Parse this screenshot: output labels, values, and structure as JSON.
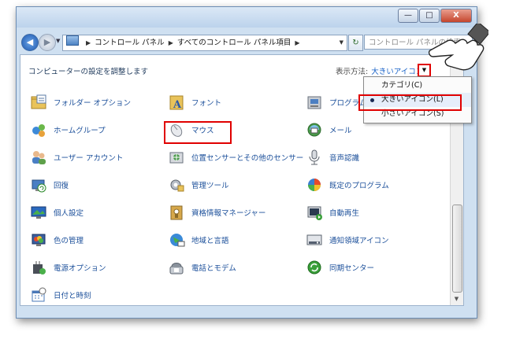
{
  "window": {
    "min_label": "—",
    "max_label": "□",
    "close_label": "X"
  },
  "address": {
    "crumb1": "コントロール パネル",
    "crumb2": "すべてのコントロール パネル項目",
    "search_placeholder": "コントロール パネルの検索"
  },
  "content": {
    "heading": "コンピューターの設定を調整します",
    "view_by_label": "表示方法:",
    "view_by_value": "大きいアイコン"
  },
  "items": [
    {
      "label": "フォルダー オプション",
      "icon": "folder-options-icon"
    },
    {
      "label": "フォント",
      "icon": "fonts-icon"
    },
    {
      "label": "プログラム",
      "icon": "programs-icon"
    },
    {
      "label": "ホームグループ",
      "icon": "homegroup-icon"
    },
    {
      "label": "マウス",
      "icon": "mouse-icon"
    },
    {
      "label": "メール",
      "icon": "mail-icon"
    },
    {
      "label": "ユーザー アカウント",
      "icon": "user-accounts-icon"
    },
    {
      "label": "位置センサーとその他のセンサー",
      "icon": "location-sensors-icon"
    },
    {
      "label": "音声認識",
      "icon": "speech-recognition-icon"
    },
    {
      "label": "回復",
      "icon": "recovery-icon"
    },
    {
      "label": "管理ツール",
      "icon": "admin-tools-icon"
    },
    {
      "label": "既定のプログラム",
      "icon": "default-programs-icon"
    },
    {
      "label": "個人設定",
      "icon": "personalization-icon"
    },
    {
      "label": "資格情報マネージャー",
      "icon": "credential-manager-icon"
    },
    {
      "label": "自動再生",
      "icon": "autoplay-icon"
    },
    {
      "label": "色の管理",
      "icon": "color-management-icon"
    },
    {
      "label": "地域と言語",
      "icon": "region-language-icon"
    },
    {
      "label": "通知領域アイコン",
      "icon": "notification-icons-icon"
    },
    {
      "label": "電源オプション",
      "icon": "power-options-icon"
    },
    {
      "label": "電話とモデム",
      "icon": "phone-modem-icon"
    },
    {
      "label": "同期センター",
      "icon": "sync-center-icon"
    },
    {
      "label": "日付と時刻",
      "icon": "date-time-icon"
    }
  ],
  "view_menu": {
    "options": [
      "カテゴリ(C)",
      "大きいアイコン(L)",
      "小さいアイコン(S)"
    ],
    "selected": "大きいアイコン(L)"
  }
}
